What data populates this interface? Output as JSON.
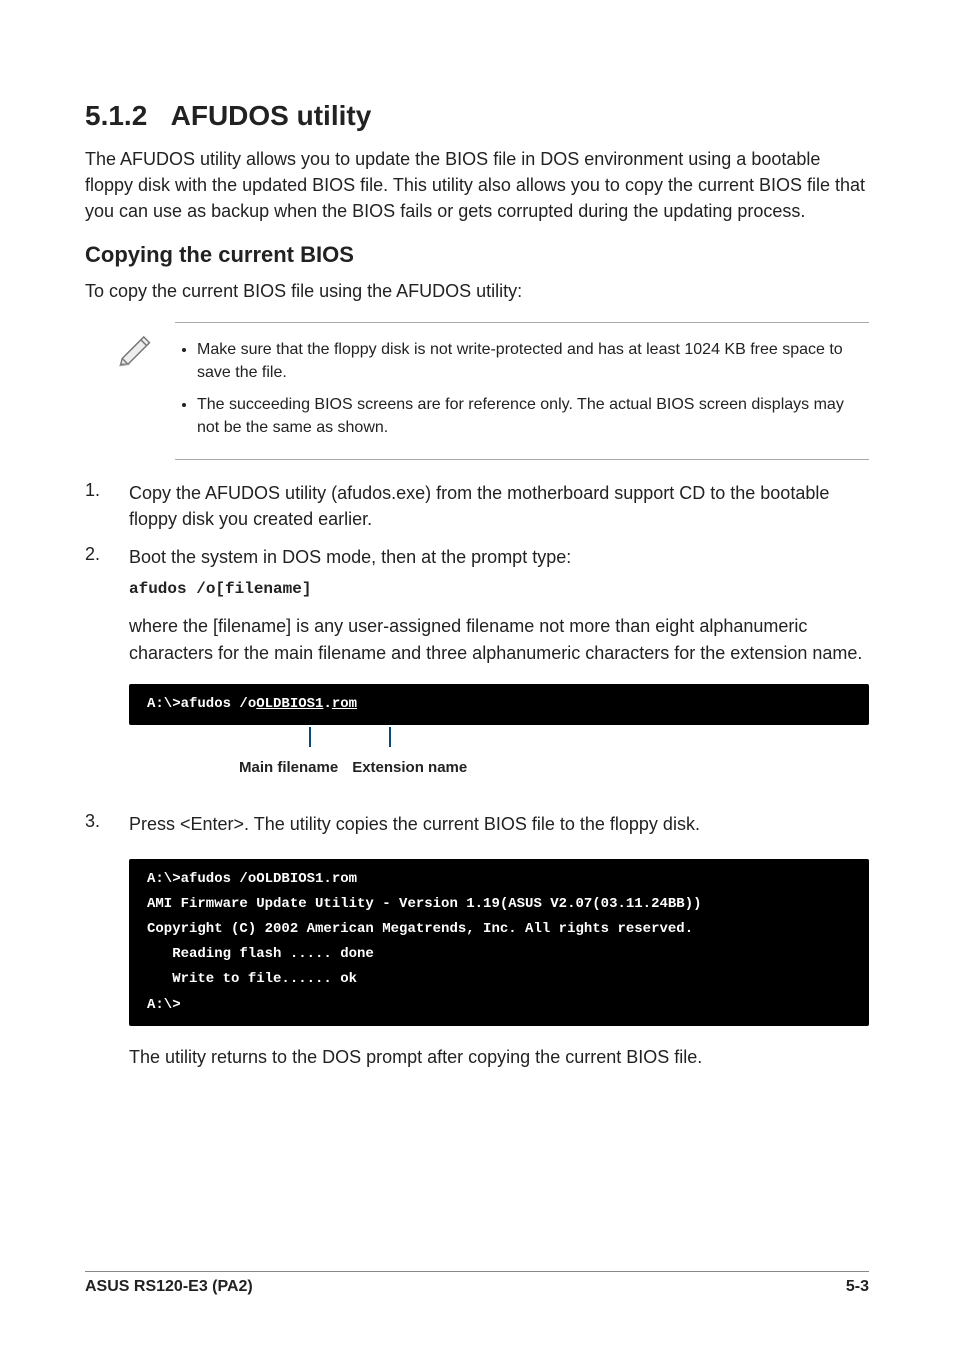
{
  "heading_num": "5.1.2",
  "heading_text": "AFUDOS utility",
  "intro": "The AFUDOS utility allows you to update the BIOS file in DOS environment using a bootable floppy disk with the updated BIOS file. This utility also allows you to copy the current BIOS file that you can use as backup when the BIOS fails or gets corrupted during the updating process.",
  "sub_heading": "Copying the current BIOS",
  "sub_intro": "To copy the current BIOS file using the AFUDOS utility:",
  "notes": [
    "Make sure that the floppy disk is not write-protected and has at least 1024 KB free space to save the file.",
    "The succeeding BIOS screens are for reference only. The actual BIOS screen displays may not be the same as shown."
  ],
  "steps": {
    "1": {
      "text": "Copy the AFUDOS utility (afudos.exe) from the motherboard support CD to the bootable floppy disk you created earlier."
    },
    "2": {
      "text": "Boot the system in DOS mode, then at the prompt type:",
      "code": "afudos /o[filename]",
      "after": "where the [filename] is any user-assigned filename not more than eight alphanumeric characters  for the main filename and three alphanumeric characters for the extension name."
    },
    "3": {
      "text": "Press <Enter>. The utility copies the current BIOS file to the floppy disk."
    }
  },
  "terminal1": {
    "prefix": "A:\\>afudos /o",
    "main": "OLDBIOS1",
    "dot": ".",
    "ext": "rom"
  },
  "anno": {
    "label1": "Main filename",
    "label2": "Extension name"
  },
  "terminal2": "A:\\>afudos /oOLDBIOS1.rom\nAMI Firmware Update Utility - Version 1.19(ASUS V2.07(03.11.24BB))\nCopyright (C) 2002 American Megatrends, Inc. All rights reserved.\n   Reading flash ..... done\n   Write to file...... ok\nA:\\>",
  "after_terminal2": "The utility returns to the DOS prompt after copying the current BIOS file.",
  "footer": {
    "left": "ASUS RS120-E3 (PA2)",
    "right": "5-3"
  }
}
